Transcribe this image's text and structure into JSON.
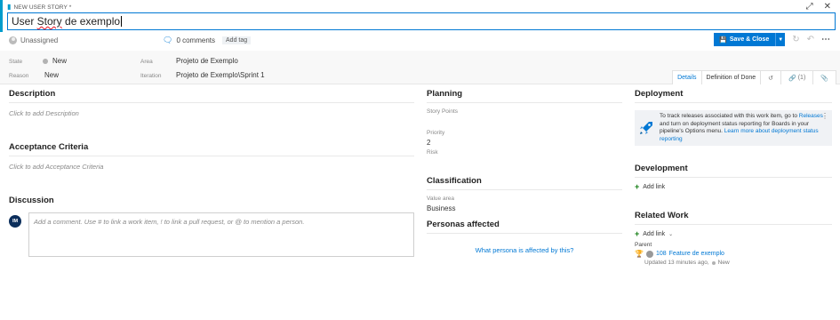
{
  "header": {
    "work_item_type": "NEW USER STORY *",
    "title": "User Story de exemplo",
    "expand_icon": "expand-icon",
    "close_icon": "close-icon"
  },
  "meta": {
    "assignee": "Unassigned",
    "comments": "0 comments",
    "add_tag": "Add tag",
    "save_label": "Save & Close"
  },
  "fields": {
    "state_label": "State",
    "state_value": "New",
    "reason_label": "Reason",
    "reason_value": "New",
    "area_label": "Area",
    "area_value": "Projeto de Exemplo",
    "iteration_label": "Iteration",
    "iteration_value": "Projeto de Exemplo\\Sprint 1"
  },
  "tabs": {
    "details": "Details",
    "definition_of_done": "Definition of Done",
    "links_count": "(1)"
  },
  "left": {
    "description_title": "Description",
    "description_placeholder": "Click to add Description",
    "acceptance_title": "Acceptance Criteria",
    "acceptance_placeholder": "Click to add Acceptance Criteria",
    "discussion_title": "Discussion",
    "discussion_avatar": "IM",
    "discussion_placeholder": "Add a comment. Use # to link a work item, ! to link a pull request, or @ to mention a person."
  },
  "middle": {
    "planning_title": "Planning",
    "story_points_label": "Story Points",
    "priority_label": "Priority",
    "priority_value": "2",
    "risk_label": "Risk",
    "classification_title": "Classification",
    "value_area_label": "Value area",
    "value_area_value": "Business",
    "personas_title": "Personas affected",
    "personas_link": "What persona is affected by this?"
  },
  "right": {
    "deployment_title": "Deployment",
    "deploy_text_1": "To track releases associated with this work item, go to ",
    "deploy_link_releases": "Releases",
    "deploy_text_2": " and turn on deployment status reporting for Boards in your pipeline's Options menu. ",
    "deploy_link_learn": "Learn more about deployment status reporting",
    "development_title": "Development",
    "add_link": "Add link",
    "related_title": "Related Work",
    "related_add_link": "Add link",
    "parent_label": "Parent",
    "parent_id": "108",
    "parent_title": "Feature de exemplo",
    "parent_updated": "Updated 13 minutes ago,",
    "parent_state": "New"
  },
  "colors": {
    "accent": "#009ccc",
    "primary": "#0078d4",
    "feature_purple": "#773b93"
  }
}
